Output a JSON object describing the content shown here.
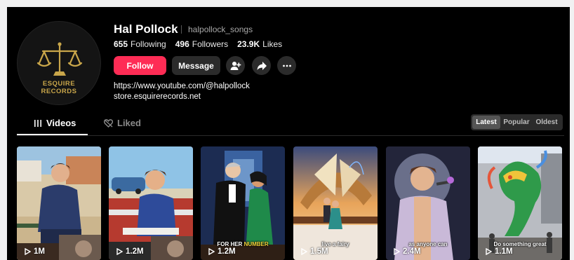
{
  "profile": {
    "avatar_line1": "ESQUIRE",
    "avatar_line2": "RECORDS",
    "name": "Hal Pollock",
    "handle": "halpollock_songs",
    "stats": {
      "following_count": "655",
      "following_label": "Following",
      "followers_count": "496",
      "followers_label": "Followers",
      "likes_count": "23.9K",
      "likes_label": "Likes"
    },
    "buttons": {
      "follow": "Follow",
      "message": "Message"
    },
    "links": [
      "https://www.youtube.com/@halpollock",
      "store.esquirerecords.net"
    ]
  },
  "tabs": {
    "videos": "Videos",
    "liked": "Liked"
  },
  "sort": {
    "latest": "Latest",
    "popular": "Popular",
    "oldest": "Oldest",
    "active": "Latest"
  },
  "videos": [
    {
      "views": "1M",
      "caption": ""
    },
    {
      "views": "1.2M",
      "caption": ""
    },
    {
      "views": "1.2M",
      "caption_pre": "FOR HER ",
      "caption_hl": "NUMBER"
    },
    {
      "views": "1.5M",
      "caption": "live a fairy"
    },
    {
      "views": "2.4M",
      "caption": "as anyone can"
    },
    {
      "views": "1.1M",
      "caption": "Do something great"
    }
  ],
  "colors": {
    "accent": "#fe2c55",
    "gold": "#c9a64a",
    "background": "#000000"
  },
  "icons": [
    "add-friend-icon",
    "share-icon",
    "more-icon",
    "videos-grid-icon",
    "liked-icon",
    "play-icon"
  ]
}
